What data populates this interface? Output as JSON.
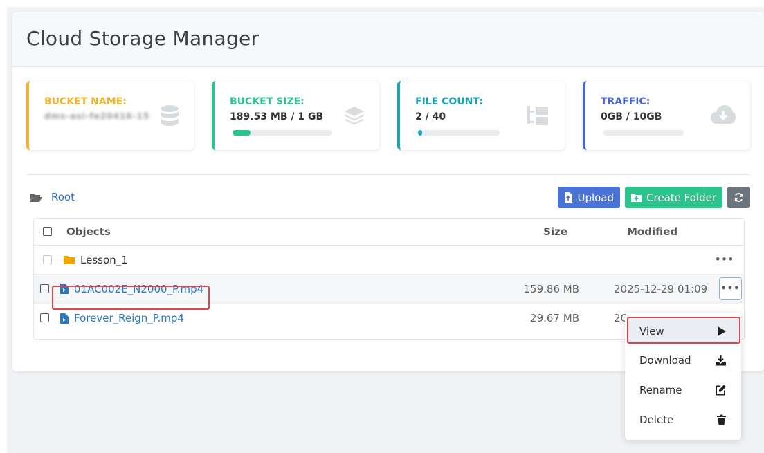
{
  "app": {
    "title": "Cloud Storage Manager"
  },
  "stats": [
    {
      "label": "Bucket Name:",
      "value": "dms-asi-fe20416-15",
      "color": "#f0b429",
      "icon": "database-icon"
    },
    {
      "label": "Bucket Size:",
      "value": "189.53 MB / 1 GB",
      "color": "#2bc48a",
      "progress_percent": 18,
      "icon": "layers-icon"
    },
    {
      "label": "File Count:",
      "value": "2 / 40",
      "color": "#17a2b8",
      "progress_percent": 5,
      "icon": "folder-tree-icon"
    },
    {
      "label": "Traffic:",
      "value": "0GB / 10GB",
      "color": "#4a66d1",
      "progress_percent": 0,
      "icon": "cloud-download-icon"
    }
  ],
  "breadcrumb": {
    "label": "Root",
    "icon": "folder-open-icon"
  },
  "toolbar": {
    "upload_label": "Upload",
    "create_folder_label": "Create Folder",
    "refresh_icon": "refresh-icon"
  },
  "table": {
    "headers": {
      "objects": "Objects",
      "size": "Size",
      "modified": "Modified"
    },
    "rows": [
      {
        "type": "folder",
        "name": "Lesson_1",
        "size": "",
        "modified": "",
        "icon": "folder-icon"
      },
      {
        "type": "file",
        "name": "01AC002E_N2000_P.mp4",
        "size": "159.86 MB",
        "modified": "2025-12-29 01:09",
        "icon": "file-video-icon"
      },
      {
        "type": "file",
        "name": "Forever_Reign_P.mp4",
        "size": "29.67 MB",
        "modified": "2C",
        "icon": "file-video-icon"
      }
    ],
    "more_glyph": "•••"
  },
  "context_menu": {
    "items": [
      {
        "label": "View",
        "icon": "play-icon"
      },
      {
        "label": "Download",
        "icon": "download-icon"
      },
      {
        "label": "Rename",
        "icon": "edit-icon"
      },
      {
        "label": "Delete",
        "icon": "trash-icon"
      }
    ]
  },
  "colors": {
    "link": "#2a78c2",
    "upload": "#4a73d7",
    "create_folder": "#2bc48a",
    "refresh": "#6c757d",
    "highlight": "#e0454b",
    "folder": "#f0a500"
  }
}
